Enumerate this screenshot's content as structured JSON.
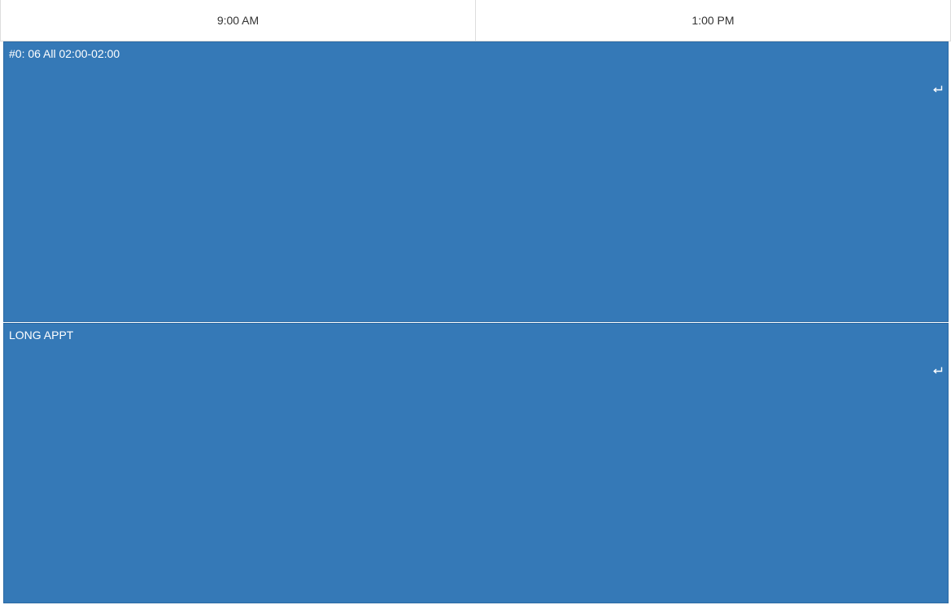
{
  "header": {
    "slots": [
      {
        "label": "9:00 AM"
      },
      {
        "label": "1:00 PM"
      }
    ]
  },
  "events": [
    {
      "title": "#0: 06 All 02:00-02:00",
      "icon": "recurring-icon"
    },
    {
      "title": "LONG APPT",
      "icon": "recurring-icon"
    }
  ],
  "colors": {
    "event_bg": "#3579b7",
    "event_border": "#2c6aa4",
    "grid_line": "#dddddd"
  }
}
